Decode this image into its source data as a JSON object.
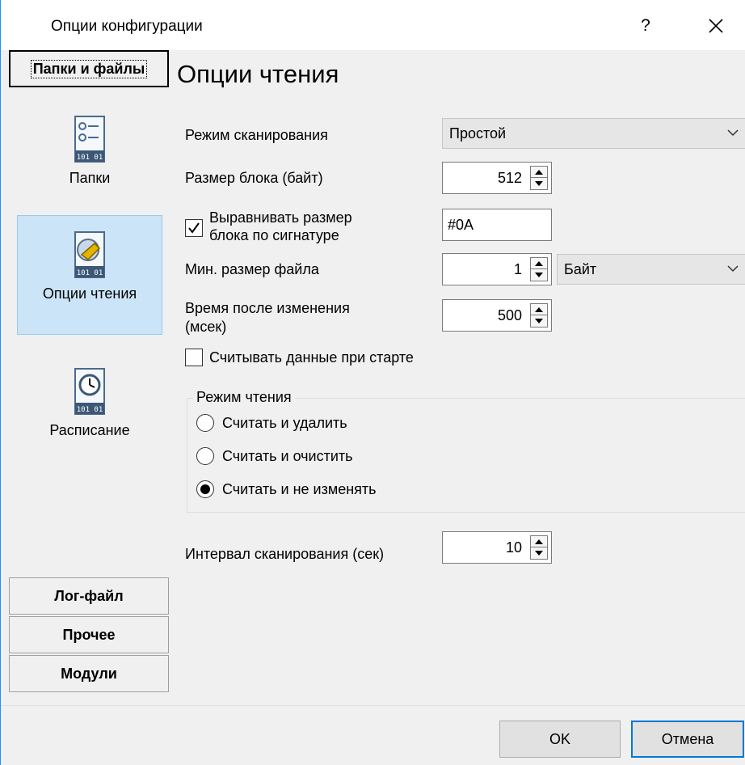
{
  "window": {
    "title": "Опции конфигурации",
    "help_label": "?",
    "close_label": "✕"
  },
  "left": {
    "top_section": "Папки и файлы",
    "nav_items": [
      {
        "label": "Папки",
        "icon": "folders-icon"
      },
      {
        "label": "Опции чтения",
        "icon": "read-options-icon"
      },
      {
        "label": "Расписание",
        "icon": "schedule-icon"
      }
    ],
    "bottom_sections": [
      "Лог-файл",
      "Прочее",
      "Модули"
    ]
  },
  "main": {
    "heading": "Опции чтения",
    "scan_mode": {
      "label": "Режим сканирования",
      "value": "Простой"
    },
    "block_size": {
      "label": "Размер блока (байт)",
      "value": "512"
    },
    "align_block": {
      "label_line1": "Выравнивать размер",
      "label_line2": "блока по сигнатуре",
      "checked": true,
      "value": "#0A"
    },
    "min_file_size": {
      "label": "Мин. размер файла",
      "value": "1",
      "unit": "Байт"
    },
    "time_after_change": {
      "label_line1": "Время после изменения",
      "label_line2": "(мсек)",
      "value": "500"
    },
    "read_on_start": {
      "label": "Считывать данные при старте",
      "checked": false
    },
    "read_mode": {
      "title": "Режим чтения",
      "options": [
        {
          "label": "Считать и удалить",
          "selected": false
        },
        {
          "label": "Считать и очистить",
          "selected": false
        },
        {
          "label": "Считать и не изменять",
          "selected": true
        }
      ]
    },
    "scan_interval": {
      "label": "Интервал сканирования (сек)",
      "value": "10"
    }
  },
  "footer": {
    "ok_label": "OK",
    "cancel_label": "Отмена"
  }
}
